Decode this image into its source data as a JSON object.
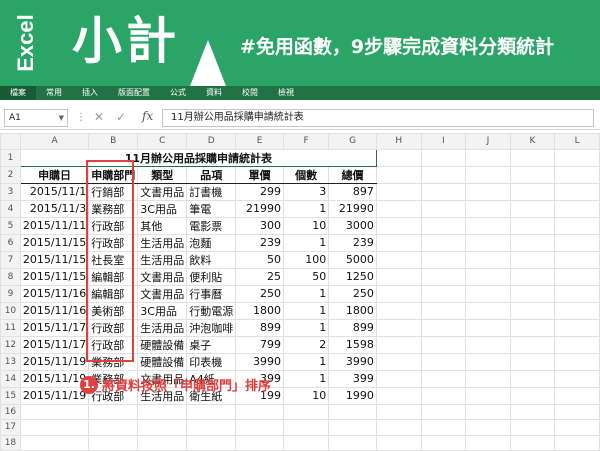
{
  "banner": {
    "brand": "Excel",
    "title": "小計",
    "subtitle": "#免用函數，9步驟完成資料分類統計",
    "bg_color": "#2aa567"
  },
  "ribbon": {
    "tabs": [
      "檔案",
      "常用",
      "插入",
      "版面配置",
      "公式",
      "資料",
      "校閱",
      "檢視"
    ]
  },
  "formula_bar": {
    "name_box": "A1",
    "cancel_icon": "✕",
    "enter_icon": "✓",
    "fx": "fx",
    "content": "11月辦公用品採購申請統計表"
  },
  "sheet": {
    "columns": [
      "A",
      "B",
      "C",
      "D",
      "E",
      "F",
      "G",
      "H",
      "I",
      "J",
      "K",
      "L"
    ],
    "row_numbers": [
      "1",
      "2",
      "3",
      "4",
      "5",
      "6",
      "7",
      "8",
      "9",
      "10",
      "11",
      "12",
      "13",
      "14",
      "15",
      "16",
      "17",
      "18"
    ],
    "title": "11月辦公用品採購申請統計表",
    "headers": [
      "申購日",
      "申購部門",
      "類型",
      "品項",
      "單價",
      "個數",
      "總價"
    ],
    "rows": [
      [
        "2015/11/1",
        "行銷部",
        "文書用品",
        "訂書機",
        "299",
        "3",
        "897"
      ],
      [
        "2015/11/3",
        "業務部",
        "3C用品",
        "筆電",
        "21990",
        "1",
        "21990"
      ],
      [
        "2015/11/11",
        "行政部",
        "其他",
        "電影票",
        "300",
        "10",
        "3000"
      ],
      [
        "2015/11/15",
        "行政部",
        "生活用品",
        "泡麵",
        "239",
        "1",
        "239"
      ],
      [
        "2015/11/15",
        "社長室",
        "生活用品",
        "飲料",
        "50",
        "100",
        "5000"
      ],
      [
        "2015/11/15",
        "編輯部",
        "文書用品",
        "便利貼",
        "25",
        "50",
        "1250"
      ],
      [
        "2015/11/16",
        "編輯部",
        "文書用品",
        "行事曆",
        "250",
        "1",
        "250"
      ],
      [
        "2015/11/16",
        "美術部",
        "3C用品",
        "行動電源",
        "1800",
        "1",
        "1800"
      ],
      [
        "2015/11/17",
        "行政部",
        "生活用品",
        "沖泡咖啡",
        "899",
        "1",
        "899"
      ],
      [
        "2015/11/17",
        "行政部",
        "硬體設備",
        "桌子",
        "799",
        "2",
        "1598"
      ],
      [
        "2015/11/19",
        "業務部",
        "硬體設備",
        "印表機",
        "3990",
        "1",
        "3990"
      ],
      [
        "2015/11/19",
        "業務部",
        "文書用品",
        "A4紙",
        "399",
        "1",
        "399"
      ],
      [
        "2015/11/19",
        "行政部",
        "生活用品",
        "衛生紙",
        "199",
        "10",
        "1990"
      ]
    ]
  },
  "annotation": {
    "number": "1.",
    "text": "將資料按照「申購部門」排序",
    "color": "#e04040"
  }
}
